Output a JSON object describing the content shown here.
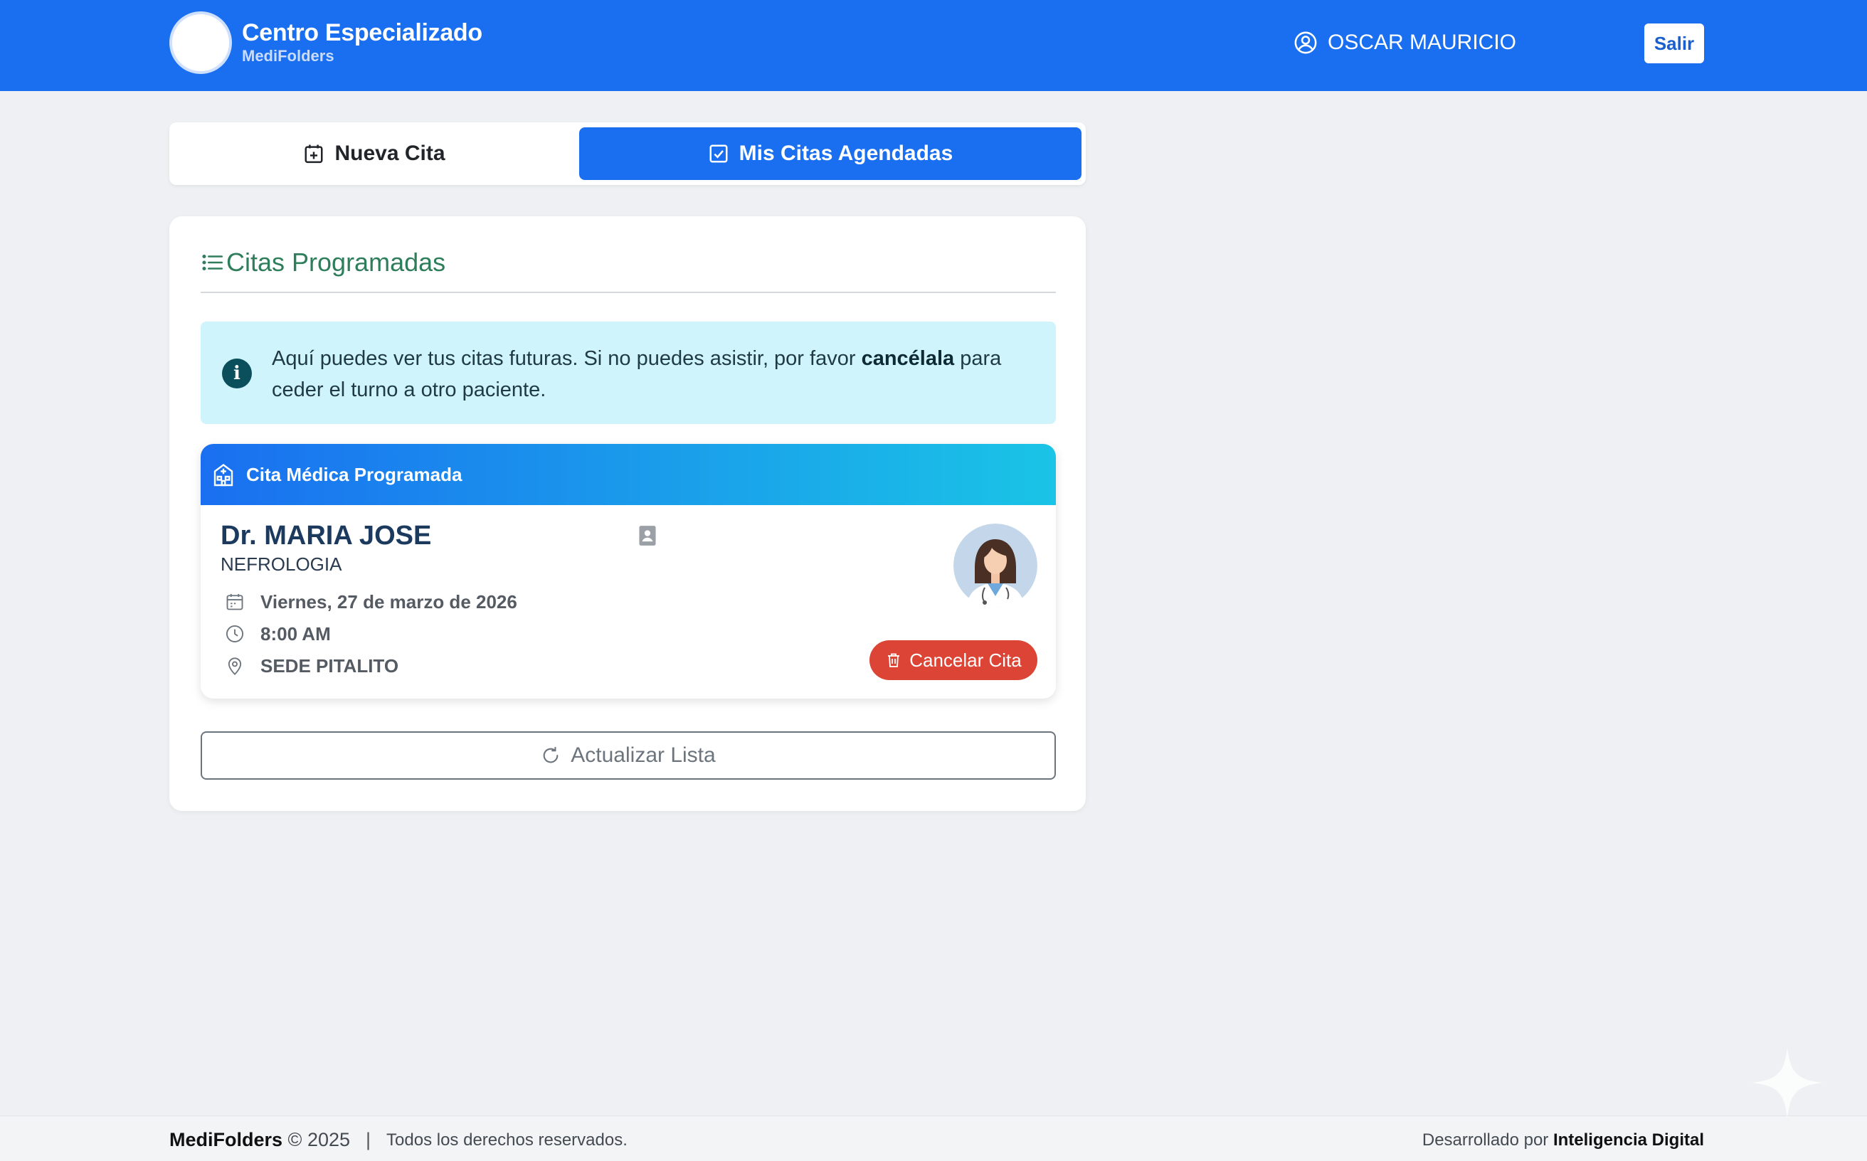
{
  "header": {
    "brand_title": "Centro Especializado",
    "brand_subtitle": "MediFolders",
    "user_name": "OSCAR MAURICIO",
    "logout_label": "Salir"
  },
  "tabs": [
    {
      "label": "Nueva Cita",
      "icon": "calendar-plus-icon",
      "active": false
    },
    {
      "label": "Mis Citas Agendadas",
      "icon": "check-square-icon",
      "active": true
    }
  ],
  "panel": {
    "title": "Citas Programadas",
    "alert": {
      "text_before": "Aquí puedes ver tus citas futuras. Si no puedes asistir, por favor ",
      "text_bold": "cancélala",
      "text_after": " para ceder el turno a otro paciente."
    },
    "appointment": {
      "header": "Cita Médica Programada",
      "doctor": "Dr. MARIA JOSE",
      "specialty": "NEFROLOGIA",
      "date": "Viernes, 27 de marzo de 2026",
      "time": "8:00 AM",
      "location": "SEDE PITALITO",
      "cancel_label": "Cancelar Cita"
    },
    "refresh_label": "Actualizar Lista"
  },
  "footer": {
    "brand": "MediFolders",
    "copyright": "© 2025",
    "separator": "|",
    "rights": "Todos los derechos reservados.",
    "developed_prefix": "Desarrollado por ",
    "developer": "Inteligencia Digital"
  },
  "colors": {
    "primary": "#1a6ff0",
    "accent_green": "#2e7d5b",
    "danger": "#dc4536",
    "alert_bg": "#cff4fc",
    "page_bg": "#eef0f3"
  }
}
